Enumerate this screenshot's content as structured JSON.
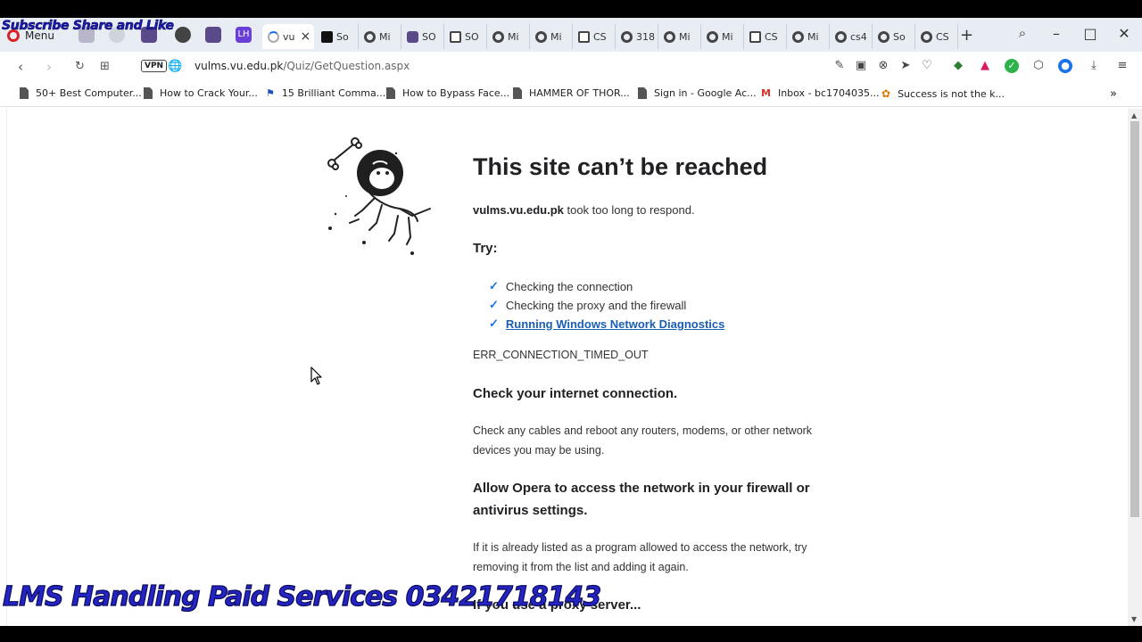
{
  "overlays": {
    "top_watermark": "Subscribe Share and Like",
    "bottom_watermark": "LMS Handling Paid Services 03421718143"
  },
  "tabstrip": {
    "menu_label": "Menu",
    "tabs": [
      {
        "label": "vu",
        "active": true,
        "icon": "loading-spinner-icon"
      },
      {
        "label": "So",
        "icon": "black-square-icon"
      },
      {
        "label": "Mi",
        "icon": "globe-icon"
      },
      {
        "label": "SO",
        "icon": "owl-icon"
      },
      {
        "label": "SO",
        "icon": "square-icon"
      },
      {
        "label": "Mi",
        "icon": "globe-icon"
      },
      {
        "label": "Mi",
        "icon": "globe-icon"
      },
      {
        "label": "CS",
        "icon": "square-icon"
      },
      {
        "label": "318",
        "icon": "globe-icon"
      },
      {
        "label": "Mi",
        "icon": "globe-icon"
      },
      {
        "label": "Mi",
        "icon": "globe-icon"
      },
      {
        "label": "CS",
        "icon": "square-icon"
      },
      {
        "label": "Mi",
        "icon": "globe-icon"
      },
      {
        "label": "cs4",
        "icon": "globe-icon"
      },
      {
        "label": "So",
        "icon": "globe-icon"
      },
      {
        "label": "CS",
        "icon": "globe-icon"
      }
    ],
    "new_tab": "+",
    "close_tab": "×"
  },
  "addressbar": {
    "vpn": "VPN",
    "url_host": "vulms.vu.edu.pk",
    "url_path": "/Quiz/GetQuestion.aspx"
  },
  "bookmarks": [
    {
      "label": "50+ Best Computer...",
      "icon": "doc-icon"
    },
    {
      "label": "How to Crack Your...",
      "icon": "doc-icon"
    },
    {
      "label": "15 Brilliant Comma...",
      "icon": "flag-icon"
    },
    {
      "label": "How to Bypass Face...",
      "icon": "doc-icon"
    },
    {
      "label": "HAMMER OF THOR...",
      "icon": "doc-icon"
    },
    {
      "label": "Sign in - Google Ac...",
      "icon": "doc-icon"
    },
    {
      "label": "Inbox - bc1704035...",
      "icon": "gmail-icon"
    },
    {
      "label": "Success is not the k...",
      "icon": "pinwheel-icon"
    }
  ],
  "error": {
    "title": "This site can’t be reached",
    "host": "vulms.vu.edu.pk",
    "message": " took too long to respond.",
    "try_label": "Try:",
    "suggestions": [
      "Checking the connection",
      "Checking the proxy and the firewall",
      "Running Windows Network Diagnostics"
    ],
    "code": "ERR_CONNECTION_TIMED_OUT",
    "section1_title": "Check your internet connection.",
    "section1_text": "Check any cables and reboot any routers, modems, or other network devices you may be using.",
    "section2_title": "Allow Opera to access the network in your firewall or antivirus settings.",
    "section2_text": "If it is already listed as a program allowed to access the network, try removing it from the list and adding it again.",
    "section3_title": "If you use a proxy server..."
  },
  "colors": {
    "link": "#1a5fb4",
    "check": "#1a73e8",
    "watermark": "#2424c4"
  }
}
